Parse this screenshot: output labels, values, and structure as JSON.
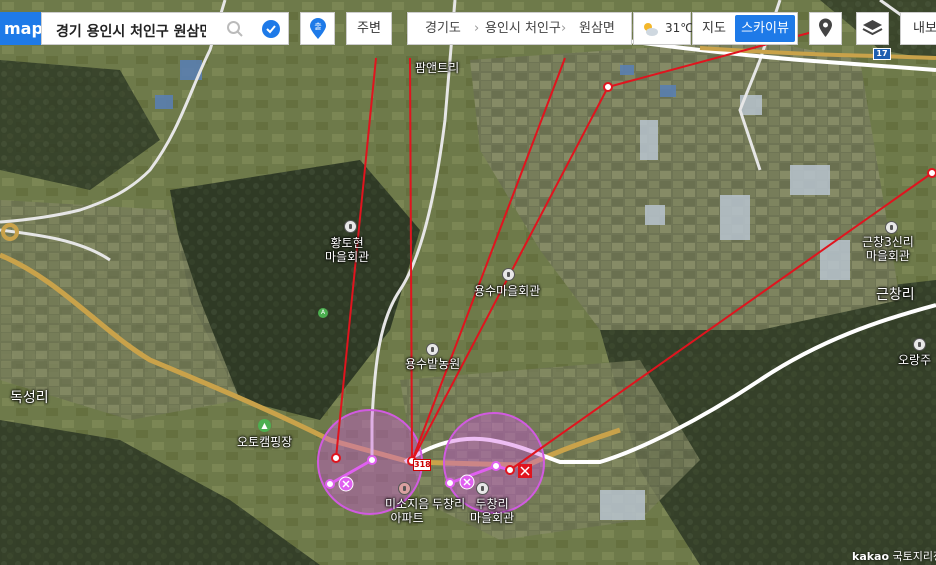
{
  "app": {
    "logo": "map"
  },
  "search": {
    "value": "경기 용인시 처인구 원삼면"
  },
  "toolbar": {
    "route_label": "출",
    "nearby_label": "주변",
    "weather_temp": "31℃",
    "map_label": "지도",
    "skyview_label": "스카이뷰",
    "export_label": "내보내기"
  },
  "breadcrumb": [
    "경기도",
    "용인시 처인구",
    "원삼면"
  ],
  "map_labels": {
    "palaentri": "팜앤트리",
    "hwangtohyeon": "황토현\n마을회관",
    "yongsu_hall": "용수마을회관",
    "yongsu_farm": "용수밭농원",
    "geunchang3": "근창3신리\n마을회관",
    "geunchangri": "근창리",
    "orangju": "오랑주",
    "dokseongri": "독성리",
    "auto_camping": "오토캠핑장",
    "misojieum": "미소지음\n아파트",
    "duchangri_a": "두창리",
    "duchangri_b": "두창리\n마을회관",
    "road_17": "17",
    "road_318": "318"
  },
  "credit": {
    "brand": "kakao",
    "source": "국토지리정보원"
  },
  "colors": {
    "accent": "#1e7ae8",
    "measure_line": "#e0141e",
    "circle_fill": "#d15be0"
  }
}
